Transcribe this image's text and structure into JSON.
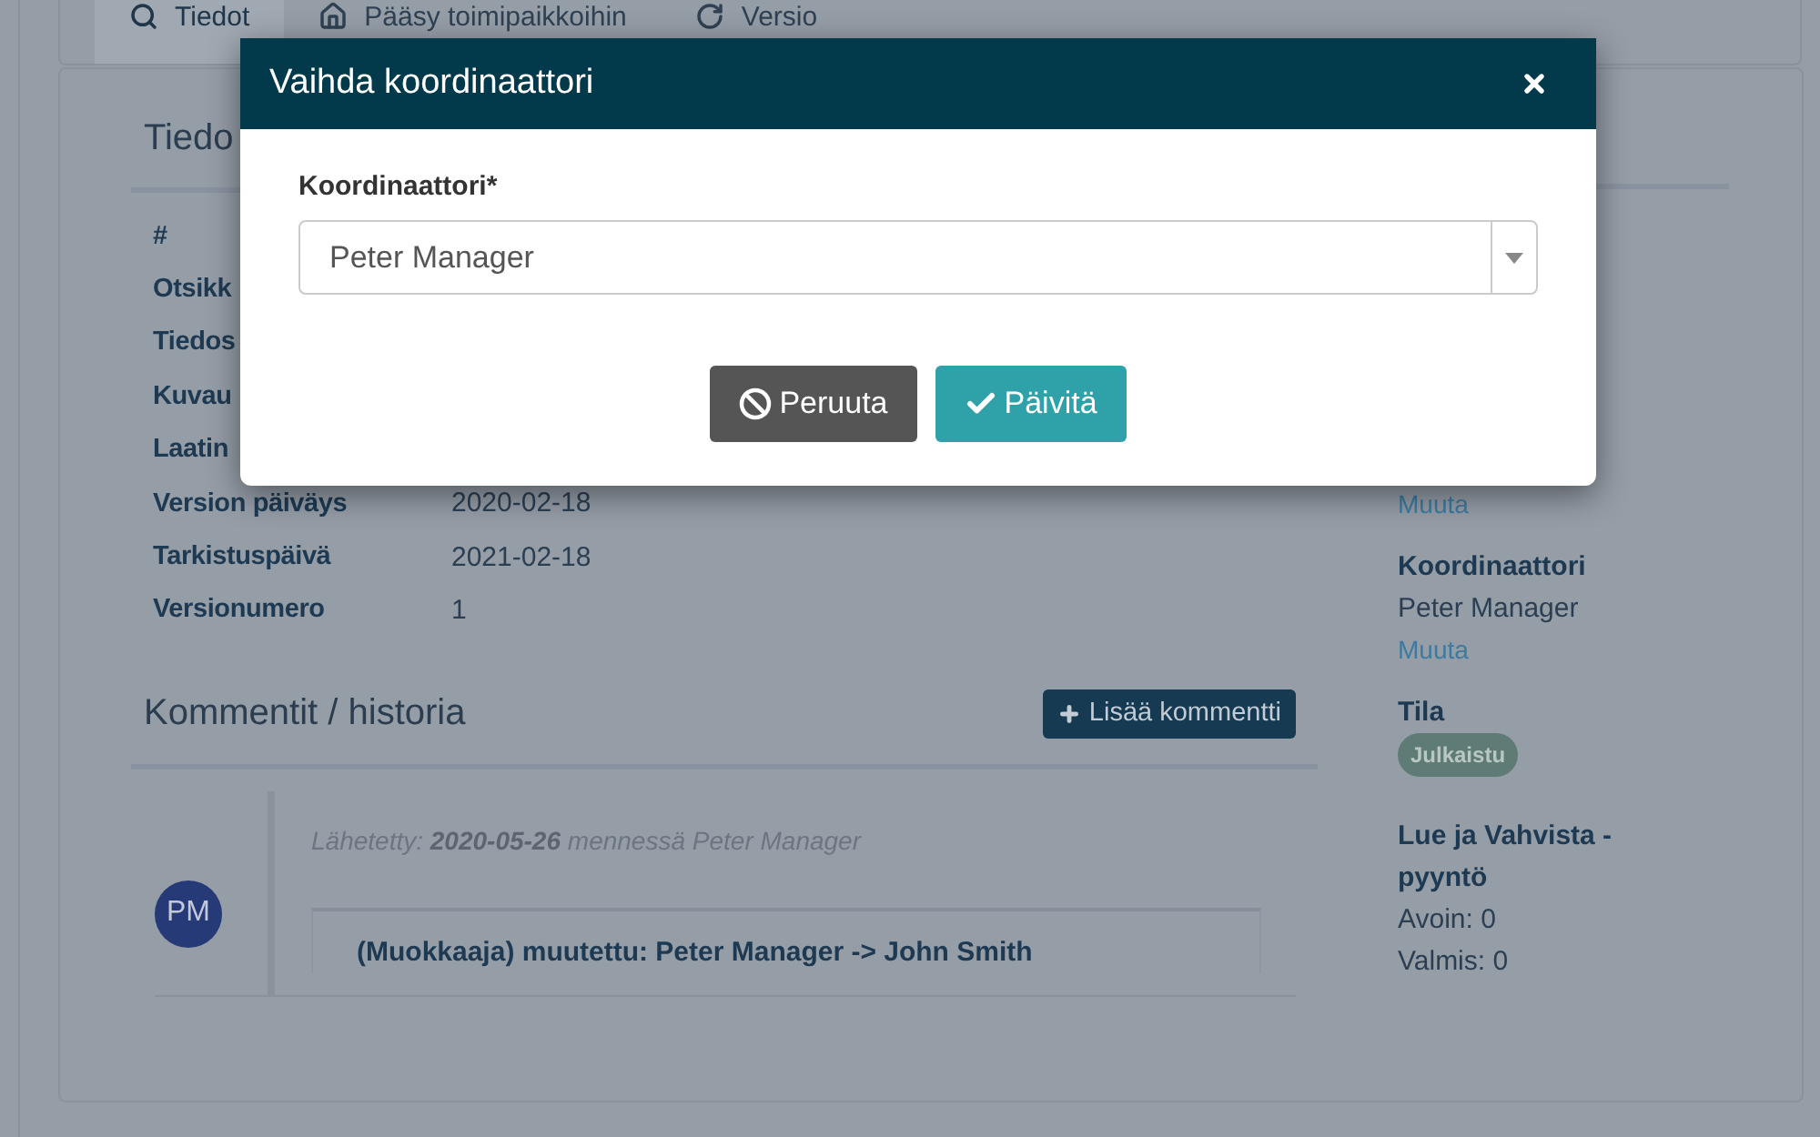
{
  "tabs": [
    {
      "label": "Tiedot",
      "selected": true
    },
    {
      "label": "Pääsy toimipaikkoihin",
      "selected": false
    },
    {
      "label": "Versio",
      "selected": false
    }
  ],
  "details": {
    "title": "Tiedo",
    "rows": [
      {
        "label": "#"
      },
      {
        "label": "Otsikk"
      },
      {
        "label": "Tiedos"
      },
      {
        "label": "Kuvau"
      },
      {
        "label": "Laatin"
      },
      {
        "label": "Version päiväys",
        "value": "2020-02-18"
      },
      {
        "label": "Tarkistuspäivä",
        "value": "2021-02-18"
      },
      {
        "label": "Versionumero",
        "value": "1"
      }
    ]
  },
  "comments": {
    "title": "Kommentit / historia",
    "add_button": "Lisää kommentti",
    "items": [
      {
        "avatar": "PM",
        "meta": "Lähetetty: **2020-05-26** mennessä Peter Manager",
        "text": "(Muokkaaja) muutettu: Peter Manager -> John Smith"
      }
    ]
  },
  "sidebar": {
    "items": [
      {
        "kind": "link",
        "text": "Muuta"
      },
      {
        "kind": "heading",
        "text": "Koordinaattori"
      },
      {
        "kind": "text",
        "text": "Peter Manager"
      },
      {
        "kind": "link",
        "text": "Muuta"
      },
      {
        "kind": "heading",
        "text": "Tila"
      },
      {
        "kind": "badge",
        "text": "Julkaistu"
      },
      {
        "kind": "heading",
        "text": "Lue ja Vahvista - pyyntö"
      },
      {
        "kind": "text",
        "text": "Avoin: 0"
      },
      {
        "kind": "text",
        "text": "Valmis: 0"
      }
    ]
  },
  "modal": {
    "title": "Vaihda koordinaattori",
    "field_label": "Koordinaattori*",
    "field_value": "Peter Manager",
    "buttons": [
      {
        "kind": "cancel",
        "label": "Peruuta"
      },
      {
        "kind": "confirm",
        "label": "Päivitä"
      }
    ]
  }
}
